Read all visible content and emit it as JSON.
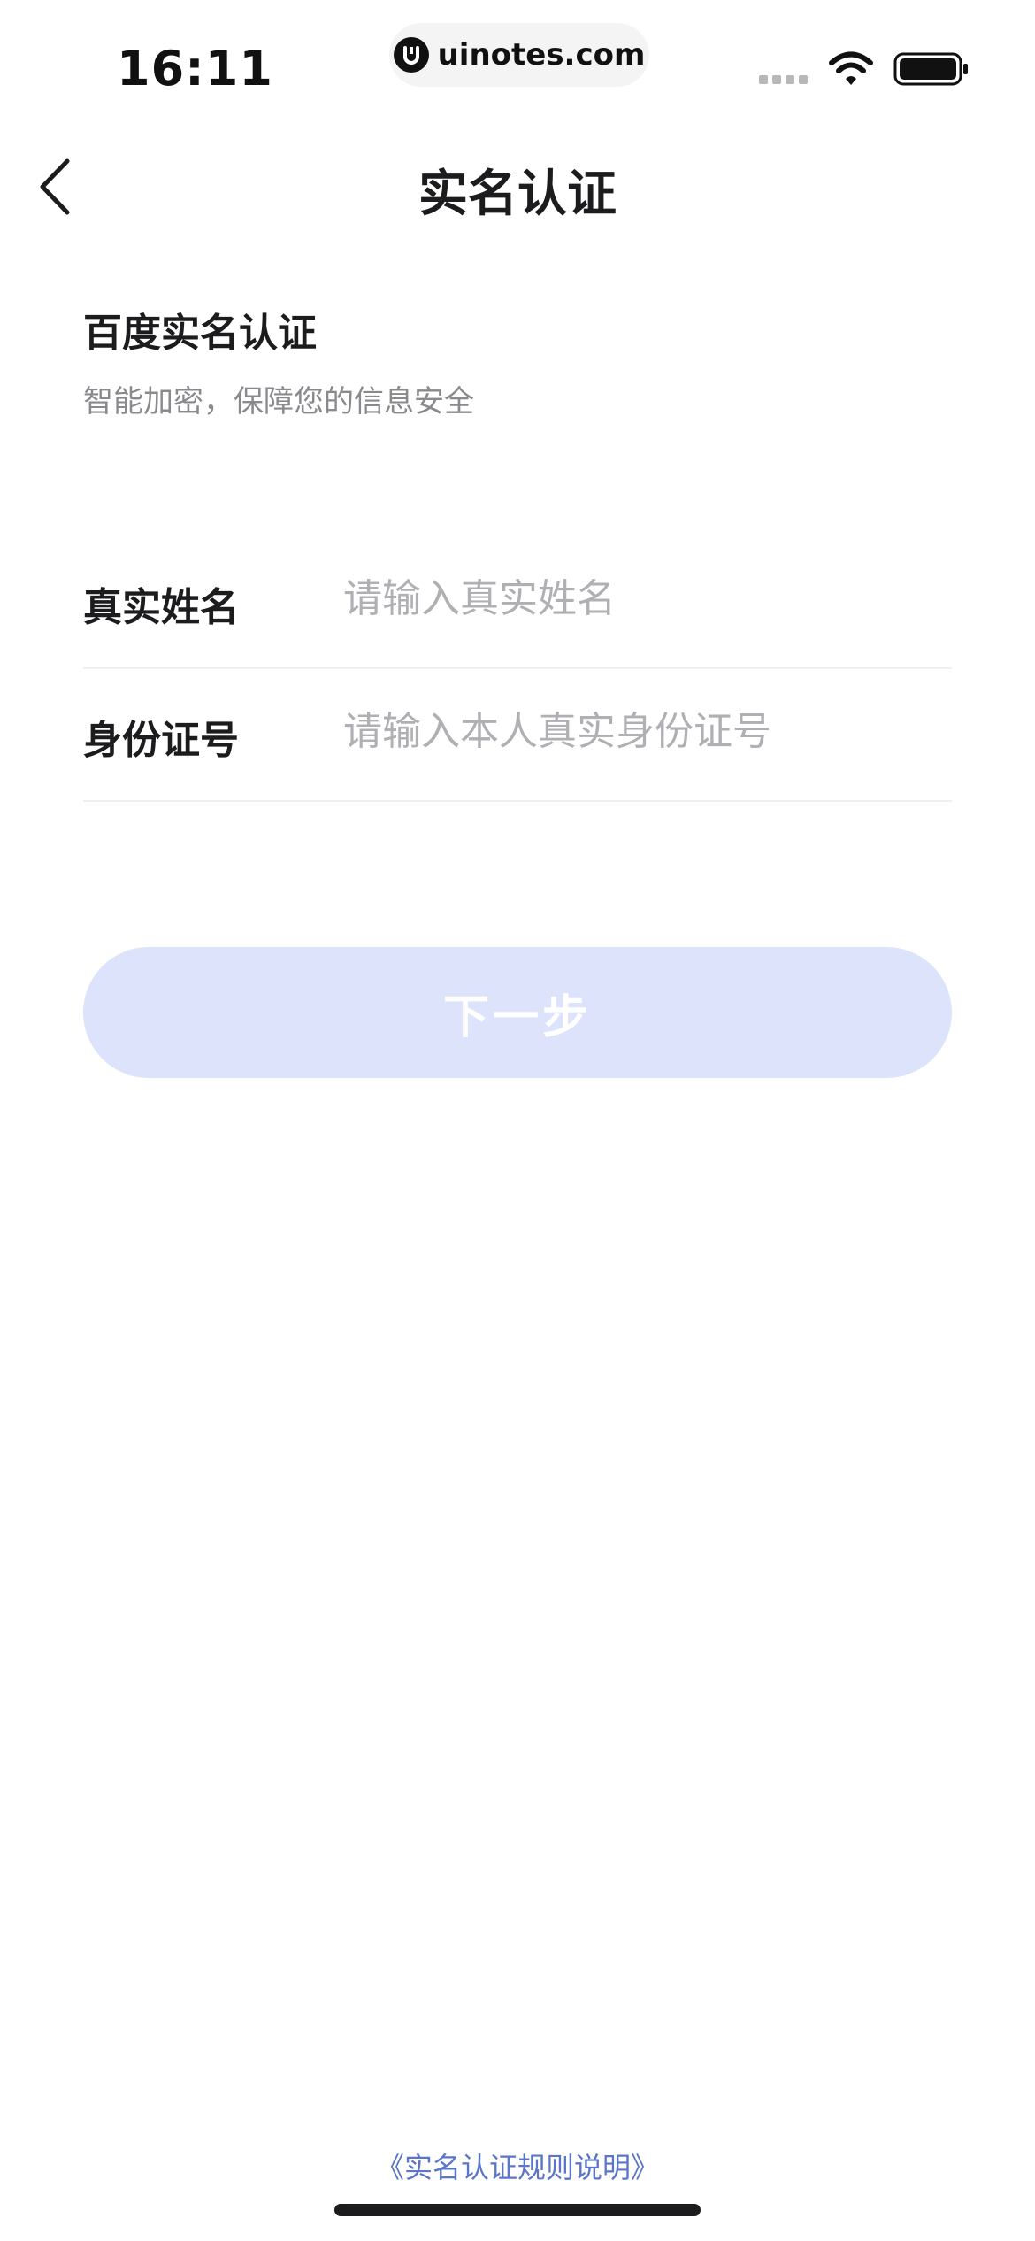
{
  "status_bar": {
    "time": "16:11",
    "url": "uinotes.com"
  },
  "nav": {
    "title": "实名认证"
  },
  "header": {
    "title": "百度实名认证",
    "subtitle": "智能加密，保障您的信息安全"
  },
  "form": {
    "name_label": "真实姓名",
    "name_placeholder": "请输入真实姓名",
    "id_label": "身份证号",
    "id_placeholder": "请输入本人真实身份证号"
  },
  "actions": {
    "next_label": "下一步"
  },
  "footer": {
    "rules_link": "《实名认证规则说明》"
  },
  "colors": {
    "button_disabled_bg": "#dde3fa",
    "link_color": "#5a75c9",
    "placeholder_color": "#b0b0b4"
  },
  "icons": {
    "back": "chevron-left-icon",
    "wifi": "wifi-icon",
    "battery": "battery-icon",
    "signal": "signal-icon",
    "site_logo": "uinotes-logo-icon"
  }
}
